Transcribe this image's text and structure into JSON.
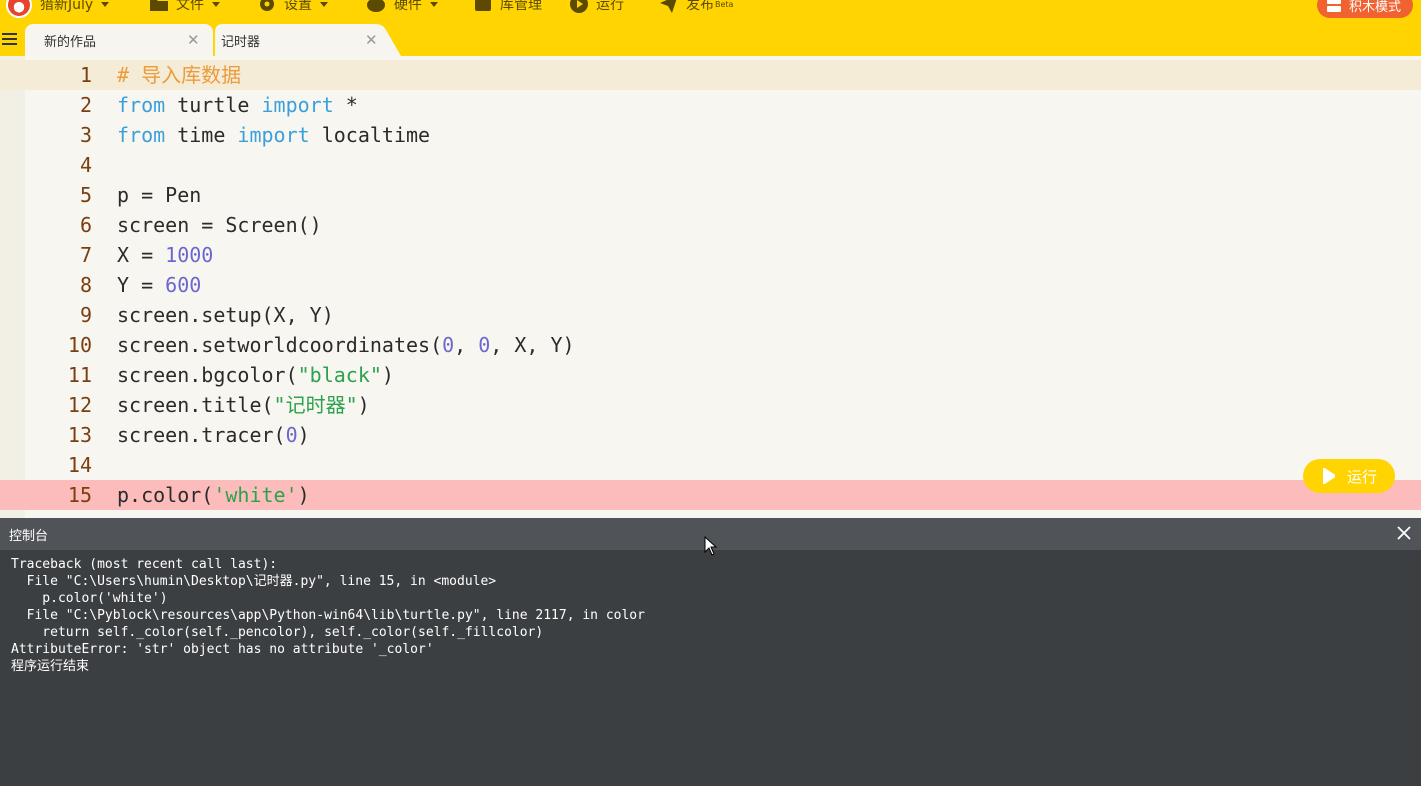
{
  "menubar": {
    "user_name": "猎新July",
    "file": "文件",
    "settings": "设置",
    "hardware": "硬件",
    "library": "库管理",
    "run": "运行",
    "publish": "发布",
    "publish_badge": "Beta",
    "block_mode": "积木模式"
  },
  "tabs": [
    {
      "label": "新的作品",
      "active": false
    },
    {
      "label": "记时器",
      "active": true
    }
  ],
  "editor": {
    "active_line": 1,
    "error_line": 15,
    "lines": [
      {
        "num": "1",
        "tokens": [
          {
            "t": "# 导入库数据",
            "c": "comment"
          }
        ]
      },
      {
        "num": "2",
        "tokens": [
          {
            "t": "from",
            "c": "kw"
          },
          {
            "t": " turtle ",
            "c": ""
          },
          {
            "t": "import",
            "c": "kw"
          },
          {
            "t": " *",
            "c": ""
          }
        ]
      },
      {
        "num": "3",
        "tokens": [
          {
            "t": "from",
            "c": "kw"
          },
          {
            "t": " time ",
            "c": ""
          },
          {
            "t": "import",
            "c": "kw"
          },
          {
            "t": " localtime",
            "c": ""
          }
        ]
      },
      {
        "num": "4",
        "tokens": []
      },
      {
        "num": "5",
        "tokens": [
          {
            "t": "p = Pen",
            "c": ""
          }
        ]
      },
      {
        "num": "6",
        "tokens": [
          {
            "t": "screen = Screen()",
            "c": ""
          }
        ]
      },
      {
        "num": "7",
        "tokens": [
          {
            "t": "X = ",
            "c": ""
          },
          {
            "t": "1000",
            "c": "num"
          }
        ]
      },
      {
        "num": "8",
        "tokens": [
          {
            "t": "Y = ",
            "c": ""
          },
          {
            "t": "600",
            "c": "num"
          }
        ]
      },
      {
        "num": "9",
        "tokens": [
          {
            "t": "screen.setup(X, Y)",
            "c": ""
          }
        ]
      },
      {
        "num": "10",
        "tokens": [
          {
            "t": "screen.setworldcoordinates(",
            "c": ""
          },
          {
            "t": "0",
            "c": "num"
          },
          {
            "t": ", ",
            "c": ""
          },
          {
            "t": "0",
            "c": "num"
          },
          {
            "t": ", X, Y)",
            "c": ""
          }
        ]
      },
      {
        "num": "11",
        "tokens": [
          {
            "t": "screen.bgcolor(",
            "c": ""
          },
          {
            "t": "\"black\"",
            "c": "str"
          },
          {
            "t": ")",
            "c": ""
          }
        ]
      },
      {
        "num": "12",
        "tokens": [
          {
            "t": "screen.title(",
            "c": ""
          },
          {
            "t": "\"记时器\"",
            "c": "str"
          },
          {
            "t": ")",
            "c": ""
          }
        ]
      },
      {
        "num": "13",
        "tokens": [
          {
            "t": "screen.tracer(",
            "c": ""
          },
          {
            "t": "0",
            "c": "num"
          },
          {
            "t": ")",
            "c": ""
          }
        ]
      },
      {
        "num": "14",
        "tokens": []
      },
      {
        "num": "15",
        "tokens": [
          {
            "t": "p.color(",
            "c": ""
          },
          {
            "t": "'white'",
            "c": "str"
          },
          {
            "t": ")",
            "c": ""
          }
        ]
      }
    ],
    "run_button": "运行"
  },
  "console": {
    "title": "控制台",
    "lines": [
      "Traceback (most recent call last):",
      "  File \"C:\\Users\\humin\\Desktop\\记时器.py\", line 15, in <module>",
      "    p.color('white')",
      "  File \"C:\\Pyblock\\resources\\app\\Python-win64\\lib\\turtle.py\", line 2117, in color",
      "    return self._color(self._pencolor), self._color(self._fillcolor)",
      "AttributeError: 'str' object has no attribute '_color'",
      "程序运行结束"
    ]
  },
  "colors": {
    "accent": "#ffd400",
    "block_mode": "#f06230",
    "editor_bg": "#f8f6f0",
    "error_line_bg": "#fdbcbc",
    "console_bg": "#3c3f42"
  }
}
